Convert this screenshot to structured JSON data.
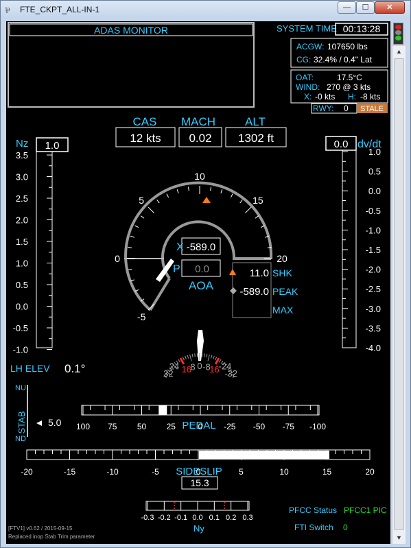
{
  "window": {
    "title": "FTE_CKPT_ALL-IN-1",
    "icon": "app-icon",
    "min_glyph": "—",
    "max_glyph": "☐",
    "close_glyph": "✕"
  },
  "adas": {
    "title": "ADAS MONITOR"
  },
  "system_time": {
    "label": "SYSTEM TIME",
    "value": "00:13:28"
  },
  "weights": {
    "acgw_label": "ACGW:",
    "acgw_value": "107650 lbs",
    "cg_label": "CG:",
    "cg_value": "32.4% / 0.4\" Lat"
  },
  "weather": {
    "oat_label": "OAT:",
    "oat_value": "17.5°C",
    "wind_label": "WIND:",
    "wind_value": "270 @ 3 kts",
    "x_label": "X:",
    "x_value": "-0 kts",
    "h_label": "H:",
    "h_value": "-8 kts"
  },
  "runway": {
    "label": "RWY:",
    "value": "0",
    "stale": "STALE"
  },
  "airdata": {
    "cas_label": "CAS",
    "cas_value": "12 kts",
    "mach_label": "MACH",
    "mach_value": "0.02",
    "alt_label": "ALT",
    "alt_value": "1302 ft"
  },
  "nz": {
    "label": "Nz",
    "value": "1.0",
    "ticks": [
      "3.5",
      "3.0",
      "2.5",
      "2.0",
      "1.5",
      "1.0",
      "0.5",
      "0.0",
      "-0.5",
      "-1.0"
    ]
  },
  "dvdt": {
    "label": "dv/dt",
    "value": "0.0",
    "ticks": [
      "1.0",
      "0.5",
      "0.0",
      "-0.5",
      "-1.0",
      "-1.5",
      "-2.0",
      "-2.5",
      "-3.0",
      "-3.5",
      "-4.0"
    ]
  },
  "aoa": {
    "label": "AOA",
    "scale": [
      "-5",
      "0",
      "5",
      "10",
      "15",
      "20"
    ],
    "x_label": "X",
    "x_value": "-589.0",
    "p_label": "P",
    "p_value": "0.0",
    "shk_value": "11.0",
    "shk_label": "SHK",
    "peak_value": "-589.0",
    "peak_label": "PEAK",
    "max_label": "MAX"
  },
  "roll": {
    "scale": [
      "32",
      "24",
      "16",
      "8",
      "0",
      "-8",
      "-16",
      "-24",
      "-32"
    ]
  },
  "elevator": {
    "label": "LH ELEV",
    "value": "0.1°"
  },
  "stab": {
    "label": "STAB",
    "nu": "NU",
    "nd": "ND",
    "value": "5.0"
  },
  "pedal": {
    "label": "PEDAL",
    "position": 0.34,
    "scale": [
      "100",
      "75",
      "50",
      "25",
      "0",
      "-25",
      "-50",
      "-75",
      "-100"
    ]
  },
  "sideslip": {
    "label": "SIDESLIP",
    "value": "15.3",
    "scale": [
      "-20",
      "-15",
      "-10",
      "-5",
      "0",
      "5",
      "10",
      "15",
      "20"
    ]
  },
  "ny": {
    "label": "Ny",
    "scale": [
      "-0.3",
      "-0.2",
      "-0.1",
      "0.0",
      "0.1",
      "0.2",
      "0.3"
    ]
  },
  "pfcc": {
    "label": "PFCC Status",
    "value": "PFCC1 PIC"
  },
  "fti": {
    "label": "FTI Switch",
    "value": "0"
  },
  "footer": {
    "version": "[FTV1] v0.62 / 2015-09-15",
    "note": "Replaced inop Stab Trim parameter"
  },
  "colors": {
    "cyan": "#33ccff",
    "white": "#ffffff",
    "green": "#22dd22",
    "orange": "#ff7a1a",
    "red": "#ff2a2a",
    "gray": "#aaaaaa",
    "stale_bg": "#c87a3a"
  }
}
